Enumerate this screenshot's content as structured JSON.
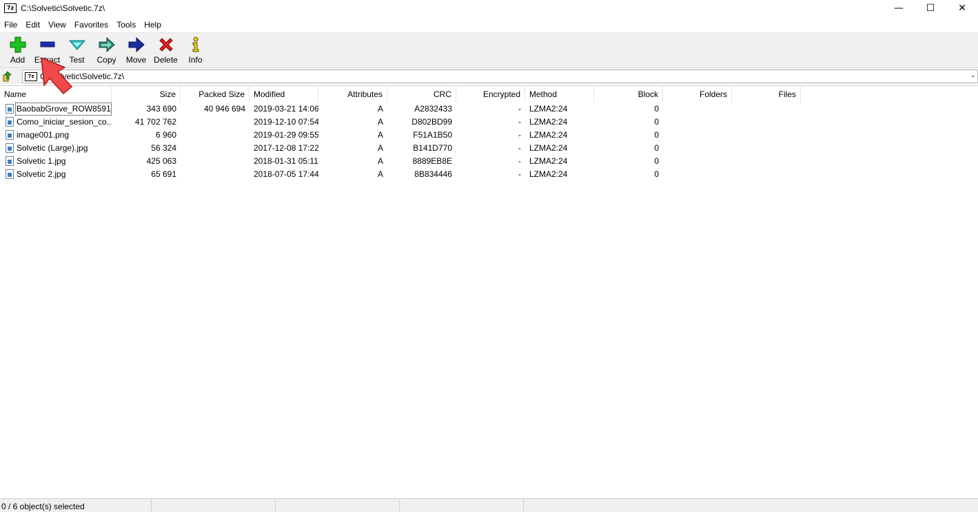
{
  "window": {
    "app_icon": "7z",
    "title": "C:\\Solvetic\\Solvetic.7z\\",
    "minimize": "—",
    "maximize": "☐",
    "close": "✕"
  },
  "menu": [
    "File",
    "Edit",
    "View",
    "Favorites",
    "Tools",
    "Help"
  ],
  "toolbar": [
    {
      "label": "Add",
      "icon": "add-icon",
      "color": "#1cc21c"
    },
    {
      "label": "Extract",
      "icon": "extract-icon",
      "color": "#1a2fb5"
    },
    {
      "label": "Test",
      "icon": "test-icon",
      "color": "#25c7c7"
    },
    {
      "label": "Copy",
      "icon": "copy-icon",
      "color": "#2c8c7a"
    },
    {
      "label": "Move",
      "icon": "move-icon",
      "color": "#1b2f9c"
    },
    {
      "label": "Delete",
      "icon": "delete-icon",
      "color": "#e01e1e"
    },
    {
      "label": "Info",
      "icon": "info-icon",
      "color": "#e5d21a"
    }
  ],
  "address": {
    "icon": "7z",
    "path": "C:\\Solvetic\\Solvetic.7z\\"
  },
  "columns": [
    "Name",
    "Size",
    "Packed Size",
    "Modified",
    "Attributes",
    "CRC",
    "Encrypted",
    "Method",
    "Block",
    "Folders",
    "Files"
  ],
  "files": [
    {
      "name": "BaobabGrove_ROW8591...",
      "size": "343 690",
      "packed": "40 946 694",
      "modified": "2019-03-21 14:06",
      "attributes": "A",
      "crc": "A2832433",
      "encrypted": "-",
      "method": "LZMA2:24",
      "block": "0",
      "folders": "",
      "files": ""
    },
    {
      "name": "Como_iniciar_sesion_co...",
      "size": "41 702 762",
      "packed": "",
      "modified": "2019-12-10 07:54",
      "attributes": "A",
      "crc": "D802BD99",
      "encrypted": "-",
      "method": "LZMA2:24",
      "block": "0",
      "folders": "",
      "files": ""
    },
    {
      "name": "image001.png",
      "size": "6 960",
      "packed": "",
      "modified": "2019-01-29 09:55",
      "attributes": "A",
      "crc": "F51A1B50",
      "encrypted": "-",
      "method": "LZMA2:24",
      "block": "0",
      "folders": "",
      "files": ""
    },
    {
      "name": "Solvetic (Large).jpg",
      "size": "56 324",
      "packed": "",
      "modified": "2017-12-08 17:22",
      "attributes": "A",
      "crc": "B141D770",
      "encrypted": "-",
      "method": "LZMA2:24",
      "block": "0",
      "folders": "",
      "files": ""
    },
    {
      "name": "Solvetic 1.jpg",
      "size": "425 063",
      "packed": "",
      "modified": "2018-01-31 05:11",
      "attributes": "A",
      "crc": "8889EB8E",
      "encrypted": "-",
      "method": "LZMA2:24",
      "block": "0",
      "folders": "",
      "files": ""
    },
    {
      "name": "Solvetic 2.jpg",
      "size": "65 691",
      "packed": "",
      "modified": "2018-07-05 17:44",
      "attributes": "A",
      "crc": "8B834446",
      "encrypted": "-",
      "method": "LZMA2:24",
      "block": "0",
      "folders": "",
      "files": ""
    }
  ],
  "status": {
    "selection": "0 / 6 object(s) selected"
  },
  "annotation": {
    "icon": "pointer-arrow-icon",
    "color": "#f04a4a"
  }
}
